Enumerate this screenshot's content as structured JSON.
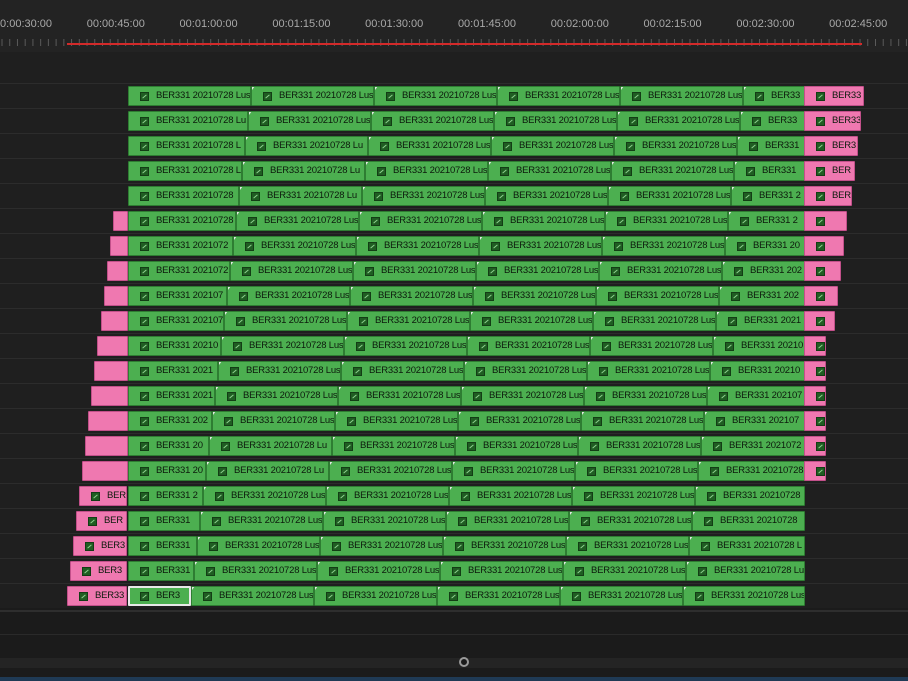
{
  "ruler": {
    "timecodes": [
      "00:00:30:00",
      "00:00:45:00",
      "00:01:00:00",
      "00:01:15:00",
      "00:01:30:00",
      "00:01:45:00",
      "00:02:00:00",
      "00:02:15:00",
      "00:02:30:00",
      "00:02:45:00"
    ]
  },
  "colors": {
    "clip_green": "#4caf50",
    "clip_pink": "#ef78b0",
    "in_out_bar": "#d32a2a"
  },
  "icons": {
    "clip": "fx-badge-icon",
    "zoom": "zoom-handle-icon"
  },
  "tracks": [
    {
      "clips": [
        {
          "c": "g",
          "t": "BER331 20210728 Lus"
        },
        {
          "c": "g",
          "t": "BER331 20210728 Lus"
        },
        {
          "c": "g",
          "t": "BER331 20210728 Lus"
        },
        {
          "c": "g",
          "t": "BER331 20210728 Lus"
        },
        {
          "c": "g",
          "t": "BER331 20210728 Lus"
        },
        {
          "c": "g",
          "t": "BER33"
        },
        {
          "c": "p",
          "t": "BER33"
        }
      ]
    },
    {
      "clips": [
        {
          "c": "g",
          "t": "BER331 20210728 Lu"
        },
        {
          "c": "g",
          "t": "BER331 20210728 Lus"
        },
        {
          "c": "g",
          "t": "BER331 20210728 Lus"
        },
        {
          "c": "g",
          "t": "BER331 20210728 Lus"
        },
        {
          "c": "g",
          "t": "BER331 20210728 Lus"
        },
        {
          "c": "g",
          "t": "BER33"
        },
        {
          "c": "p",
          "t": "BER33"
        }
      ]
    },
    {
      "clips": [
        {
          "c": "g",
          "t": "BER331 20210728 L"
        },
        {
          "c": "g",
          "t": "BER331 20210728 Lu"
        },
        {
          "c": "g",
          "t": "BER331 20210728 Lus"
        },
        {
          "c": "g",
          "t": "BER331 20210728 Lus"
        },
        {
          "c": "g",
          "t": "BER331 20210728 Lus"
        },
        {
          "c": "g",
          "t": "BER331"
        },
        {
          "c": "p",
          "t": "BER3"
        }
      ]
    },
    {
      "clips": [
        {
          "c": "g",
          "t": "BER331 20210728 L"
        },
        {
          "c": "g",
          "t": "BER331 20210728 Lu"
        },
        {
          "c": "g",
          "t": "BER331 20210728 Lus"
        },
        {
          "c": "g",
          "t": "BER331 20210728 Lus"
        },
        {
          "c": "g",
          "t": "BER331 20210728 Lus"
        },
        {
          "c": "g",
          "t": "BER331"
        },
        {
          "c": "p",
          "t": "BER"
        }
      ]
    },
    {
      "clips": [
        {
          "c": "g",
          "t": "BER331 20210728"
        },
        {
          "c": "g",
          "t": "BER331 20210728 Lu"
        },
        {
          "c": "g",
          "t": "BER331 20210728 Lus"
        },
        {
          "c": "g",
          "t": "BER331 20210728 Lus"
        },
        {
          "c": "g",
          "t": "BER331 20210728 Lus"
        },
        {
          "c": "g",
          "t": "BER331 2"
        },
        {
          "c": "p",
          "t": "BER"
        }
      ]
    },
    {
      "clips": [
        {
          "c": "g",
          "t": "BER331 20210728"
        },
        {
          "c": "g",
          "t": "BER331 20210728 Lus"
        },
        {
          "c": "g",
          "t": "BER331 20210728 Lus"
        },
        {
          "c": "g",
          "t": "BER331 20210728 Lus"
        },
        {
          "c": "g",
          "t": "BER331 20210728 Lus"
        },
        {
          "c": "g",
          "t": "BER331 2"
        },
        {
          "c": "p",
          "t": ""
        }
      ]
    },
    {
      "clips": [
        {
          "c": "g",
          "t": "BER331 2021072"
        },
        {
          "c": "g",
          "t": "BER331 20210728 Lus"
        },
        {
          "c": "g",
          "t": "BER331 20210728 Lus"
        },
        {
          "c": "g",
          "t": "BER331 20210728 Lus"
        },
        {
          "c": "g",
          "t": "BER331 20210728 Lus"
        },
        {
          "c": "g",
          "t": "BER331 20"
        },
        {
          "c": "p",
          "t": ""
        }
      ]
    },
    {
      "clips": [
        {
          "c": "g",
          "t": "BER331 2021072"
        },
        {
          "c": "g",
          "t": "BER331 20210728 Lus"
        },
        {
          "c": "g",
          "t": "BER331 20210728 Lus"
        },
        {
          "c": "g",
          "t": "BER331 20210728 Lus"
        },
        {
          "c": "g",
          "t": "BER331 20210728 Lus"
        },
        {
          "c": "g",
          "t": "BER331 202"
        },
        {
          "c": "p",
          "t": ""
        }
      ]
    },
    {
      "clips": [
        {
          "c": "g",
          "t": "BER331 202107"
        },
        {
          "c": "g",
          "t": "BER331 20210728 Lus"
        },
        {
          "c": "g",
          "t": "BER331 20210728 Lus"
        },
        {
          "c": "g",
          "t": "BER331 20210728 Lus"
        },
        {
          "c": "g",
          "t": "BER331 20210728 Lus"
        },
        {
          "c": "g",
          "t": "BER331 202"
        },
        {
          "c": "p",
          "t": ""
        }
      ]
    },
    {
      "clips": [
        {
          "c": "g",
          "t": "BER331 202107"
        },
        {
          "c": "g",
          "t": "BER331 20210728 Lus"
        },
        {
          "c": "g",
          "t": "BER331 20210728 Lus"
        },
        {
          "c": "g",
          "t": "BER331 20210728 Lus"
        },
        {
          "c": "g",
          "t": "BER331 20210728 Lus"
        },
        {
          "c": "g",
          "t": "BER331 2021"
        },
        {
          "c": "p",
          "t": ""
        }
      ]
    },
    {
      "clips": [
        {
          "c": "g",
          "t": "BER331 20210"
        },
        {
          "c": "g",
          "t": "BER331 20210728 Lus"
        },
        {
          "c": "g",
          "t": "BER331 20210728 Lus"
        },
        {
          "c": "g",
          "t": "BER331 20210728 Lus"
        },
        {
          "c": "g",
          "t": "BER331 20210728 Lus"
        },
        {
          "c": "g",
          "t": "BER331 20210"
        },
        {
          "c": "p",
          "t": ""
        }
      ]
    },
    {
      "clips": [
        {
          "c": "g",
          "t": "BER331 2021"
        },
        {
          "c": "g",
          "t": "BER331 20210728 Lus"
        },
        {
          "c": "g",
          "t": "BER331 20210728 Lus"
        },
        {
          "c": "g",
          "t": "BER331 20210728 Lus"
        },
        {
          "c": "g",
          "t": "BER331 20210728 Lus"
        },
        {
          "c": "g",
          "t": "BER331 20210"
        },
        {
          "c": "p",
          "t": ""
        }
      ]
    },
    {
      "clips": [
        {
          "c": "g",
          "t": "BER331 2021"
        },
        {
          "c": "g",
          "t": "BER331 20210728 Lus"
        },
        {
          "c": "g",
          "t": "BER331 20210728 Lus"
        },
        {
          "c": "g",
          "t": "BER331 20210728 Lus"
        },
        {
          "c": "g",
          "t": "BER331 20210728 Lus"
        },
        {
          "c": "g",
          "t": "BER331 202107"
        },
        {
          "c": "p",
          "t": ""
        }
      ]
    },
    {
      "clips": [
        {
          "c": "g",
          "t": "BER331 202"
        },
        {
          "c": "g",
          "t": "BER331 20210728 Lus"
        },
        {
          "c": "g",
          "t": "BER331 20210728 Lus"
        },
        {
          "c": "g",
          "t": "BER331 20210728 Lus"
        },
        {
          "c": "g",
          "t": "BER331 20210728 Lus"
        },
        {
          "c": "g",
          "t": "BER331 202107"
        },
        {
          "c": "p",
          "t": ""
        }
      ]
    },
    {
      "clips": [
        {
          "c": "g",
          "t": "BER331 20"
        },
        {
          "c": "g",
          "t": "BER331 20210728 Lu"
        },
        {
          "c": "g",
          "t": "BER331 20210728 Lus"
        },
        {
          "c": "g",
          "t": "BER331 20210728 Lus"
        },
        {
          "c": "g",
          "t": "BER331 20210728 Lus"
        },
        {
          "c": "g",
          "t": "BER331 2021072"
        },
        {
          "c": "p",
          "t": ""
        }
      ]
    },
    {
      "clips": [
        {
          "c": "g",
          "t": "BER331 20"
        },
        {
          "c": "g",
          "t": "BER331 20210728 Lu"
        },
        {
          "c": "g",
          "t": "BER331 20210728 Lus"
        },
        {
          "c": "g",
          "t": "BER331 20210728 Lus"
        },
        {
          "c": "g",
          "t": "BER331 20210728 Lus"
        },
        {
          "c": "g",
          "t": "BER331 20210728"
        },
        {
          "c": "p",
          "t": ""
        }
      ]
    },
    {
      "clips": [
        {
          "c": "g",
          "t": "BER331 2"
        },
        {
          "c": "g",
          "t": "BER331 20210728 Lus"
        },
        {
          "c": "g",
          "t": "BER331 20210728 Lus"
        },
        {
          "c": "g",
          "t": "BER331 20210728 Lus"
        },
        {
          "c": "g",
          "t": "BER331 20210728 Lus"
        },
        {
          "c": "g",
          "t": "BER331 20210728"
        },
        {
          "c": "p",
          "t": "BER"
        }
      ]
    },
    {
      "clips": [
        {
          "c": "g",
          "t": "BER331"
        },
        {
          "c": "g",
          "t": "BER331 20210728 Lus"
        },
        {
          "c": "g",
          "t": "BER331 20210728 Lus"
        },
        {
          "c": "g",
          "t": "BER331 20210728 Lus"
        },
        {
          "c": "g",
          "t": "BER331 20210728 Lus"
        },
        {
          "c": "g",
          "t": "BER331 20210728"
        },
        {
          "c": "p",
          "t": "BER"
        }
      ]
    },
    {
      "clips": [
        {
          "c": "g",
          "t": "BER331"
        },
        {
          "c": "g",
          "t": "BER331 20210728 Lus"
        },
        {
          "c": "g",
          "t": "BER331 20210728 Lus"
        },
        {
          "c": "g",
          "t": "BER331 20210728 Lus"
        },
        {
          "c": "g",
          "t": "BER331 20210728 Lus"
        },
        {
          "c": "g",
          "t": "BER331 20210728 L"
        },
        {
          "c": "p",
          "t": "BER3"
        }
      ]
    },
    {
      "clips": [
        {
          "c": "g",
          "t": "BER331"
        },
        {
          "c": "g",
          "t": "BER331 20210728 Lus"
        },
        {
          "c": "g",
          "t": "BER331 20210728 Lus"
        },
        {
          "c": "g",
          "t": "BER331 20210728 Lus"
        },
        {
          "c": "g",
          "t": "BER331 20210728 Lus"
        },
        {
          "c": "g",
          "t": "BER331 20210728 Lu"
        },
        {
          "c": "p",
          "t": "BER3"
        }
      ]
    },
    {
      "clips": [
        {
          "c": "g",
          "t": "BER3",
          "selected": true
        },
        {
          "c": "g",
          "t": "BER331 20210728 Lus"
        },
        {
          "c": "g",
          "t": "BER331 20210728 Lus"
        },
        {
          "c": "g",
          "t": "BER331 20210728 Lus"
        },
        {
          "c": "g",
          "t": "BER331 20210728 Lus"
        },
        {
          "c": "g",
          "t": "BER331 20210728 Lus"
        },
        {
          "c": "p",
          "t": "BER33"
        }
      ]
    }
  ]
}
